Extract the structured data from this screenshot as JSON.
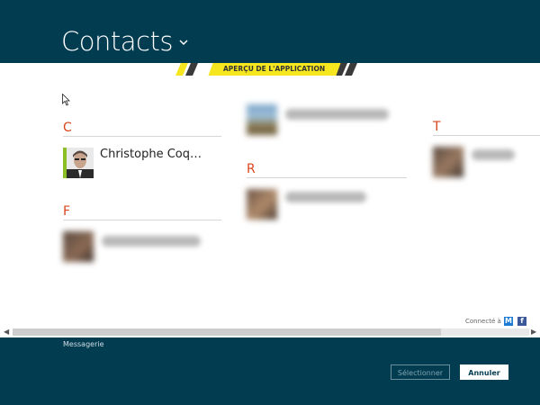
{
  "header": {
    "title": "Contacts",
    "chevron_icon": "chevron-down-icon"
  },
  "banner": {
    "label": "APERÇU DE L'APPLICATION",
    "color": "#f5e620"
  },
  "groups": [
    {
      "letter": "C",
      "contacts": [
        {
          "name": "Christophe Coq…",
          "blurred": false
        }
      ]
    },
    {
      "letter": "F",
      "contacts": [
        {
          "name": "",
          "blurred": true
        }
      ]
    },
    {
      "letter": "R",
      "contacts": [
        {
          "name": "",
          "blurred": true
        }
      ]
    },
    {
      "letter": "T",
      "contacts": [
        {
          "name": "",
          "blurred": true
        }
      ]
    }
  ],
  "unlabeled_contact": {
    "name": "",
    "blurred": true
  },
  "connected": {
    "label": "Connecté à",
    "services": [
      "messenger-icon",
      "facebook-icon"
    ]
  },
  "footer": {
    "app_name": "Messagerie",
    "select_label": "Sélectionner",
    "cancel_label": "Annuler"
  },
  "colors": {
    "accent": "#023c51",
    "letter": "#d9451c"
  }
}
